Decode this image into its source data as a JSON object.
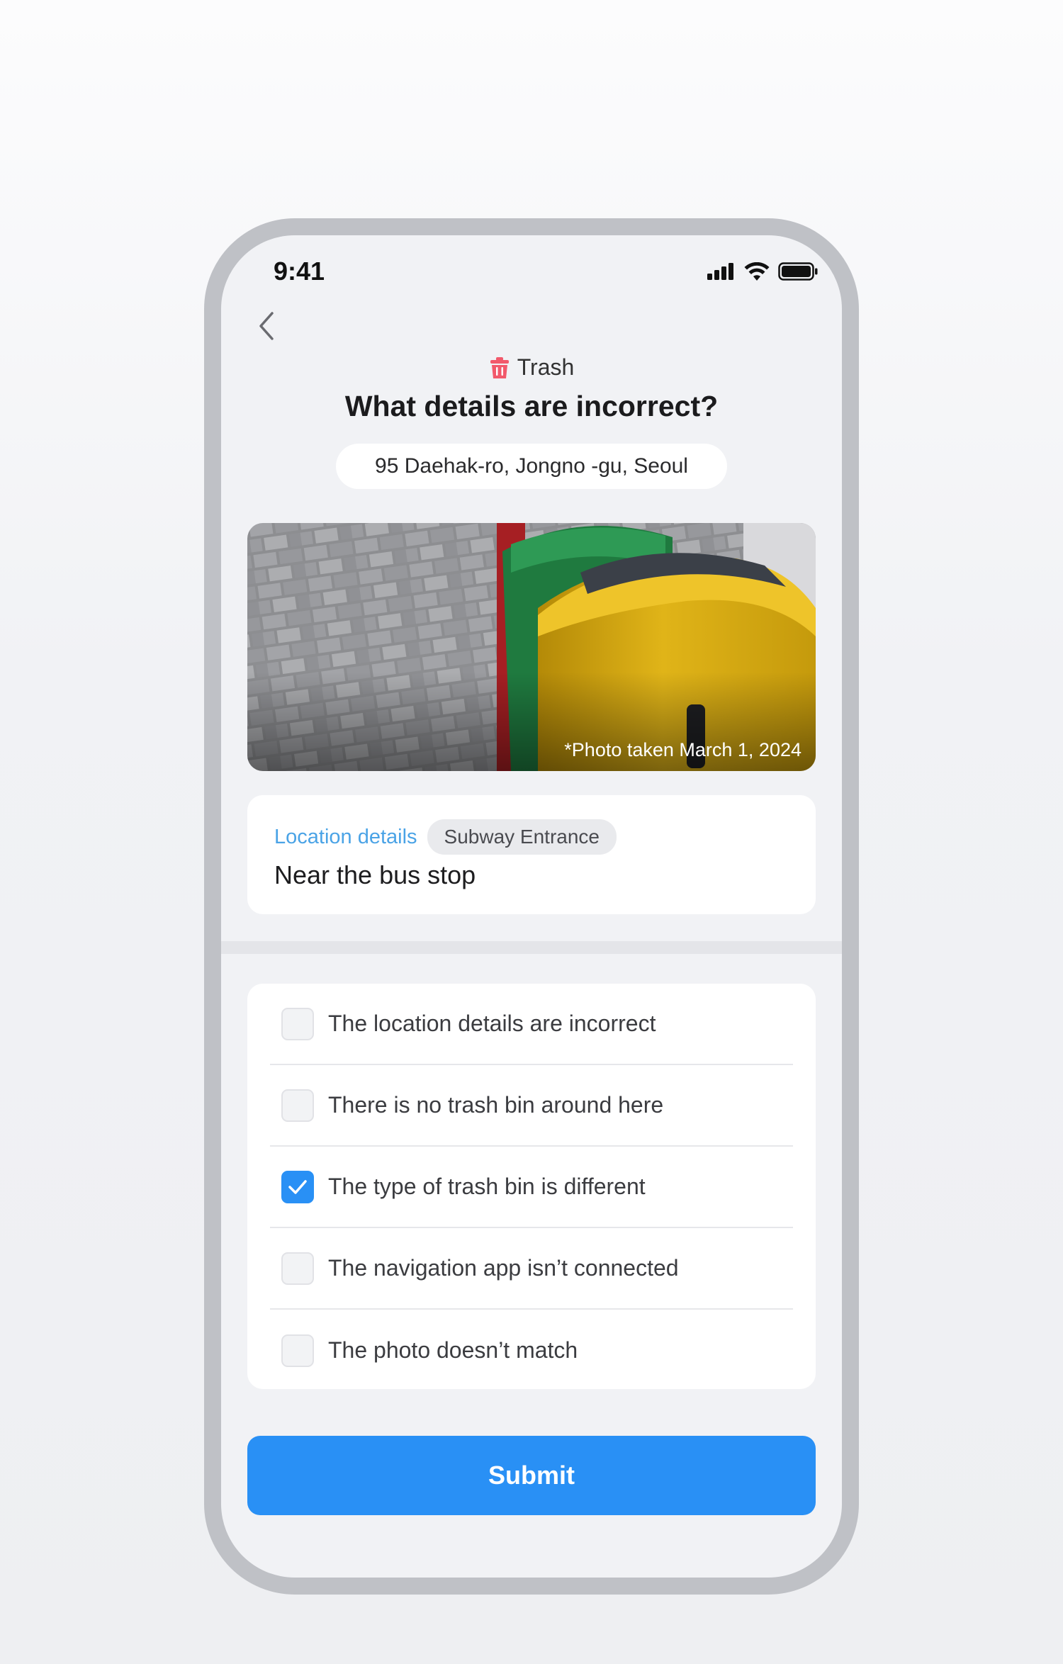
{
  "status_bar": {
    "time": "9:41",
    "icons": [
      "signal-icon",
      "wifi-icon",
      "battery-icon"
    ]
  },
  "header": {
    "back_icon": "chevron-left-icon",
    "category_icon": "trash-icon",
    "category": "Trash",
    "title": "What details are incorrect?",
    "address": "95 Daehak-ro, Jongno -gu, Seoul"
  },
  "photo": {
    "caption": "*Photo taken March 1, 2024"
  },
  "location": {
    "label": "Location details",
    "tag": "Subway Entrance",
    "text": "Near the bus stop"
  },
  "options": [
    {
      "label": "The location details are incorrect",
      "checked": false
    },
    {
      "label": "There is no trash bin around here",
      "checked": false
    },
    {
      "label": "The type of trash bin is different",
      "checked": true
    },
    {
      "label": "The navigation app isn’t connected",
      "checked": false
    },
    {
      "label": "The photo doesn’t match",
      "checked": false
    }
  ],
  "submit_label": "Submit",
  "colors": {
    "accent": "#2990f5",
    "category_icon": "#f2596b",
    "location_label": "#4aa3e6"
  }
}
